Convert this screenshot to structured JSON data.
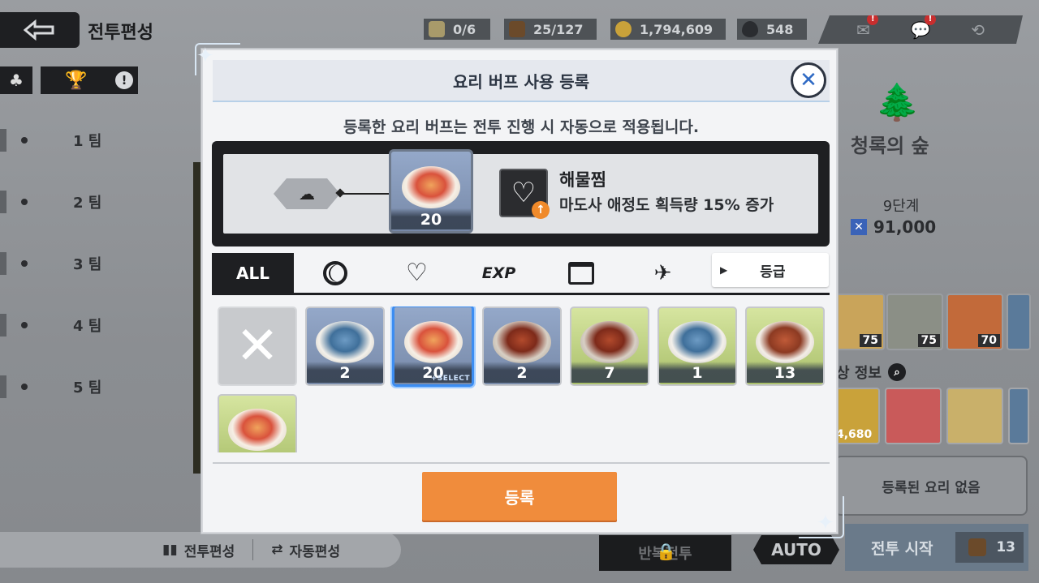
{
  "header": {
    "title": "전투편성",
    "resources": [
      {
        "icon": "card-icon",
        "value": "0/6"
      },
      {
        "icon": "boot-icon",
        "value": "25/127"
      },
      {
        "icon": "coin-icon",
        "value": "1,794,609"
      },
      {
        "icon": "gem-icon",
        "value": "548"
      }
    ],
    "right_icons": [
      "mail-icon",
      "chat-icon",
      "return-icon"
    ],
    "badge": "!"
  },
  "left": {
    "teams": [
      "1 팀",
      "2 팀",
      "3 팀",
      "4 팀",
      "5 팀"
    ],
    "warning": "!"
  },
  "right_panel": {
    "location": "청록의 숲",
    "stage": "9단계",
    "power": "91,000",
    "characters": [
      {
        "level": "75"
      },
      {
        "level": "75"
      },
      {
        "level": "70"
      }
    ],
    "reward_label": "상 정보",
    "reward_value": "4,680",
    "no_food": "등록된 요리 없음"
  },
  "bottom": {
    "formation": "전투편성",
    "auto_formation": "자동편성",
    "repeat": "반복전투",
    "auto": "AUTO",
    "start": "전투 시작",
    "start_cost": "13"
  },
  "modal": {
    "title": "요리 버프 사용 등록",
    "subtitle": "등록한 요리 버프는 전투 진행 시 자동으로 적용됩니다.",
    "selected": {
      "count": "20",
      "name": "해물찜",
      "description": "마도사 애정도 획득량 15% 증가"
    },
    "tabs": [
      "ALL",
      "ring-icon",
      "heart-icon",
      "EXP",
      "chest-icon",
      "wing-icon"
    ],
    "active_tab": "ALL",
    "sort_label": "등급",
    "items": [
      {
        "type": "none"
      },
      {
        "count": "2",
        "dish": "fish",
        "bg": "blue"
      },
      {
        "count": "20",
        "dish": "seafood",
        "bg": "blue",
        "selected": true,
        "tag": "+SELECT"
      },
      {
        "count": "2",
        "dish": "stew",
        "bg": "blue"
      },
      {
        "count": "7",
        "dish": "stew",
        "bg": "green"
      },
      {
        "count": "1",
        "dish": "fish",
        "bg": "green"
      },
      {
        "count": "13",
        "dish": "meat",
        "bg": "green"
      },
      {
        "count": "",
        "dish": "seafood",
        "bg": "green"
      }
    ],
    "register": "등록",
    "close": "✕"
  }
}
